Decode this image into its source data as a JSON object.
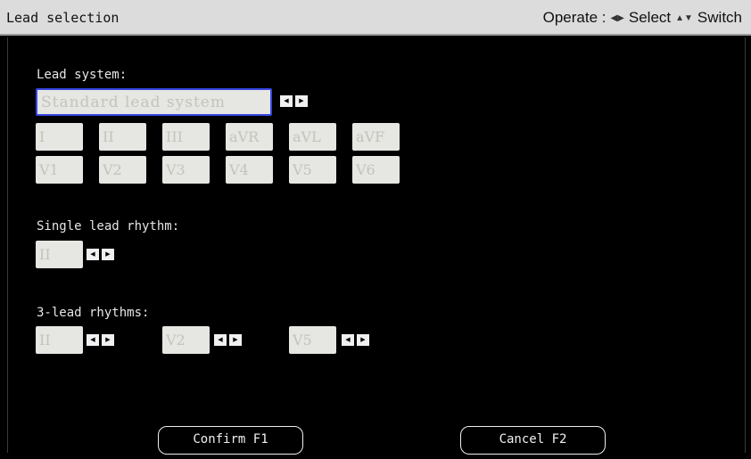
{
  "window": {
    "title": "Lead selection",
    "hint_prefix": "Operate :",
    "hint_select": "Select",
    "hint_switch": "Switch",
    "icons": [
      "left-right-icon",
      "up-down-icon"
    ]
  },
  "lead_system": {
    "label": "Lead system:",
    "value": "Standard lead system",
    "row1": [
      "I",
      "II",
      "III",
      "aVR",
      "aVL",
      "aVF"
    ],
    "row2": [
      "V1",
      "V2",
      "V3",
      "V4",
      "V5",
      "V6"
    ]
  },
  "single_lead": {
    "label": "Single lead rhythm:",
    "value": "II"
  },
  "three_lead": {
    "label": "3-lead rhythms:",
    "values": [
      "II",
      "V2",
      "V5"
    ]
  },
  "buttons": {
    "confirm": "Confirm F1",
    "cancel": "Cancel F2"
  },
  "colors": {
    "background": "#000000",
    "titlebar": "#dcdcdc",
    "field": "#e6e6e2",
    "focus_border": "#3547e0"
  }
}
